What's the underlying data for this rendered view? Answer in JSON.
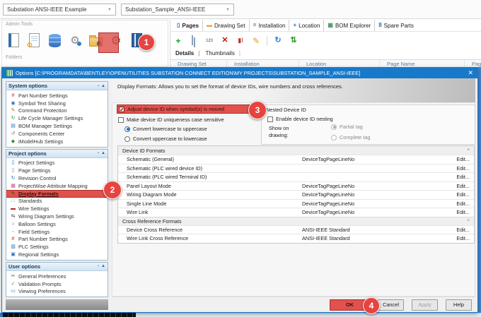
{
  "app": {
    "project_selector": "Substation ANSI-IEEE Example",
    "drawing_selector": "Substation_Sample_ANSI-IEEE",
    "admin_panel": {
      "title": "Admin Tools",
      "folders": "Folders"
    },
    "admin_icons": [
      "notebook-icon",
      "report-gear-icon",
      "database-icon",
      "system-info-icon",
      "project-folder-icon",
      "options-gear-icon",
      "catalog-icon"
    ],
    "nav_tabs": [
      {
        "label": "Pages",
        "icon": "page-icon",
        "selected": true
      },
      {
        "label": "Drawing Set",
        "icon": "folder-icon"
      },
      {
        "label": "Installation",
        "icon": "equals-icon"
      },
      {
        "label": "Location",
        "icon": "plus-icon"
      },
      {
        "label": "BOM Explorer",
        "icon": "bom-icon"
      },
      {
        "label": "Spare Parts",
        "icon": "spare-parts-icon"
      }
    ],
    "toolbar_icons": [
      "add-page-icon",
      "copy-pages-icon",
      "renumber-pages-icon",
      "delete-icon",
      "rename-icon",
      "edit-icon",
      "separator",
      "refresh-icon",
      "sync-icon"
    ],
    "view_tabs": [
      {
        "label": "Details",
        "selected": true
      },
      {
        "label": "Thumbnails"
      }
    ],
    "grid_headers": [
      "Drawing Set",
      "Installation",
      "Location",
      "Page Name",
      "Page Mod"
    ]
  },
  "dialog": {
    "title": "Options [C:\\PROGRAMDATA\\BENTLEY\\OPENUTILITIES SUBSTATION CONNECT EDITION\\MY PROJECTS\\SUBSTATION_SAMPLE_ANSI-IEEE]",
    "close_glyph": "✕",
    "description": "Display Formats: Allows you to set the format of device IDs, wire numbers and cross references.",
    "sidebar": {
      "sections": [
        {
          "title": "System options",
          "items": [
            {
              "label": "Part Number Settings",
              "icon": "#",
              "color": "#cc2222"
            },
            {
              "label": "Symbol Text Sharing",
              "icon": "◉",
              "color": "#2a6fb8"
            },
            {
              "label": "Command Protection",
              "icon": "✎",
              "color": "#a06a1a"
            },
            {
              "label": "Life Cycle Manager Settings",
              "icon": "↻",
              "color": "#2a9a2a"
            },
            {
              "label": "BOM Manager Settings",
              "icon": "▤",
              "color": "#2a6fb8"
            },
            {
              "label": "Components Center",
              "icon": "↺",
              "color": "#777777"
            },
            {
              "label": "iModelHub Settings",
              "icon": "◆",
              "color": "#3a8a3a"
            }
          ]
        },
        {
          "title": "Project options",
          "items": [
            {
              "label": "Project Settings",
              "icon": "▯",
              "color": "#2a6fb8"
            },
            {
              "label": "Page Settings",
              "icon": "▯",
              "color": "#8a8a8a"
            },
            {
              "label": "Revision Control",
              "icon": "↻",
              "color": "#2a6fb8"
            },
            {
              "label": "ProjectWise Attribute Mapping",
              "icon": "▦",
              "color": "#c05588"
            },
            {
              "label": "Display Formats",
              "icon": "✎",
              "color": "#6a5a2a",
              "highlight": true
            },
            {
              "label": "Standards",
              "icon": "□",
              "color": "#888888"
            },
            {
              "label": "Wire Settings",
              "icon": "▬",
              "color": "#cc2222"
            },
            {
              "label": "Wiring Diagram Settings",
              "icon": "⇆",
              "color": "#333333"
            },
            {
              "label": "Balloon Settings",
              "icon": "○",
              "color": "#2a6fb8"
            },
            {
              "label": "Field Settings",
              "icon": "▫",
              "color": "#4a90d9"
            },
            {
              "label": "Part Number Settings",
              "icon": "#",
              "color": "#cc2222"
            },
            {
              "label": "PLC Settings",
              "icon": "▥",
              "color": "#2a6fb8"
            },
            {
              "label": "Regional Settings",
              "icon": "▣",
              "color": "#2a6fb8"
            }
          ]
        },
        {
          "title": "User options",
          "items": [
            {
              "label": "General Preferences",
              "icon": "✂",
              "color": "#555555"
            },
            {
              "label": "Validation Prompts",
              "icon": "✓",
              "color": "#2a9a2a"
            },
            {
              "label": "Viewing Preferences",
              "icon": "▭",
              "color": "#2a6fb8"
            }
          ]
        }
      ]
    },
    "settings": {
      "adjust_device_id": "Adjust device ID when symbol(s) is moved",
      "case_sensitive": "Make device ID uniqueness case sensitive",
      "lower_to_upper": "Convert lowercase to uppercase",
      "upper_to_lower": "Convert uppercase to lowercase",
      "nested_group_title": "Nested Device ID",
      "enable_nesting": "Enable device ID nesting",
      "show_on_drawing": "Show on drawing:",
      "partial_tag": "Partial tag",
      "complete_tag": "Complete tag"
    },
    "format_table": {
      "sections": [
        {
          "header": "Device ID Formats",
          "rows": [
            [
              "Schematic (General)",
              "DeviceTagPageLineNo",
              "Edit..."
            ],
            [
              "Schematic (PLC wired device ID)",
              "",
              "Edit..."
            ],
            [
              "Schematic (PLC wired Terminal ID)",
              "",
              "Edit..."
            ],
            [
              "Panel Layout Mode",
              "DeviceTagPageLineNo",
              "Edit..."
            ],
            [
              "Wiring Diagram Mode",
              "DeviceTagPageLineNo",
              "Edit..."
            ],
            [
              "Single Line Mode",
              "DeviceTagPageLineNo",
              "Edit..."
            ],
            [
              "Wire Link",
              "DeviceTagPageLineNo",
              "Edit..."
            ]
          ]
        },
        {
          "header": "Cross Reference Formats",
          "rows": [
            [
              "Device Cross Reference",
              "ANSI-IEEE Standard",
              "Edit..."
            ],
            [
              "Wire Link Cross Reference",
              "ANSI-IEEE Standard",
              "Edit..."
            ]
          ]
        }
      ]
    },
    "buttons": {
      "ok": "OK",
      "cancel": "Cancel",
      "apply": "Apply",
      "help": "Help"
    }
  },
  "callouts": {
    "step1": "1",
    "step2": "2",
    "step3": "3",
    "step4": "4"
  },
  "colors": {
    "accent_blue": "#1879cb",
    "highlight_red": "#e2514d",
    "badge_red": "#e8433e"
  }
}
